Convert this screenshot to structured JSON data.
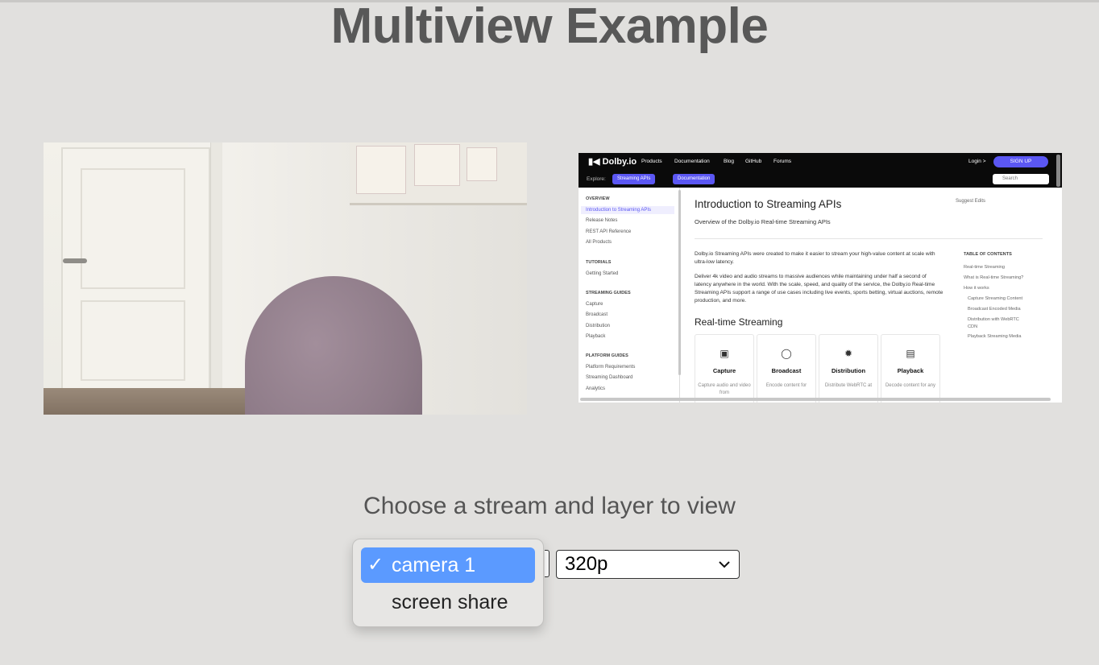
{
  "page": {
    "title": "Multiview Example"
  },
  "screen_share": {
    "brand": "Dolby.io",
    "nav": [
      "Products",
      "Documentation",
      "Blog",
      "GitHub",
      "Forums"
    ],
    "login": "Login >",
    "signup": "SIGN UP",
    "explore_label": "Explore:",
    "pills": [
      "Streaming APIs",
      "Documentation"
    ],
    "search_placeholder": "Search",
    "sidebar": {
      "overview_head": "OVERVIEW",
      "overview": [
        "Introduction to Streaming APIs",
        "Release Notes",
        "REST API Reference",
        "All Products"
      ],
      "tutorials_head": "TUTORIALS",
      "tutorials": [
        "Getting Started"
      ],
      "streaming_head": "STREAMING GUIDES",
      "streaming": [
        "Capture",
        "Broadcast",
        "Distribution",
        "Playback"
      ],
      "platform_head": "PLATFORM GUIDES",
      "platform": [
        "Platform Requirements",
        "Streaming Dashboard",
        "Analytics"
      ]
    },
    "heading": "Introduction to Streaming APIs",
    "subheading": "Overview of the Dolby.io Real-time Streaming APIs",
    "suggest_edits": "Suggest Edits",
    "para1": "Dolby.io Streaming APIs were created to make it easier to stream your high-value content at scale with ultra-low latency.",
    "para2": "Deliver 4k video and audio streams to massive audiences while maintaining under half a second of latency anywhere in the world. With the scale, speed, and quality of the service, the Dolby.io Real-time Streaming APIs support a range of use cases including live events, sports betting, virtual auctions, remote production, and more.",
    "section_heading": "Real-time Streaming",
    "toc_head": "TABLE OF CONTENTS",
    "toc": [
      "Real-time Streaming",
      "What is Real-time Streaming?",
      "How it works",
      "Capture Streaming Content",
      "Broadcast Encoded Media",
      "Distribution with WebRTC",
      "CDN",
      "Playback Streaming Media"
    ],
    "cards": [
      {
        "title": "Capture",
        "desc": "Capture audio and video from"
      },
      {
        "title": "Broadcast",
        "desc": "Encode content for"
      },
      {
        "title": "Distribution",
        "desc": "Distribute WebRTC at"
      },
      {
        "title": "Playback",
        "desc": "Decode content for any"
      }
    ]
  },
  "controls": {
    "choose_label": "Choose a stream and layer to view",
    "stream_options": [
      "camera 1",
      "screen share"
    ],
    "stream_selected": "camera 1",
    "layer_selected": "320p"
  },
  "colors": {
    "background": "#e1e0de",
    "accent": "#5b9aff",
    "dolby_purple": "#5b57f3"
  }
}
